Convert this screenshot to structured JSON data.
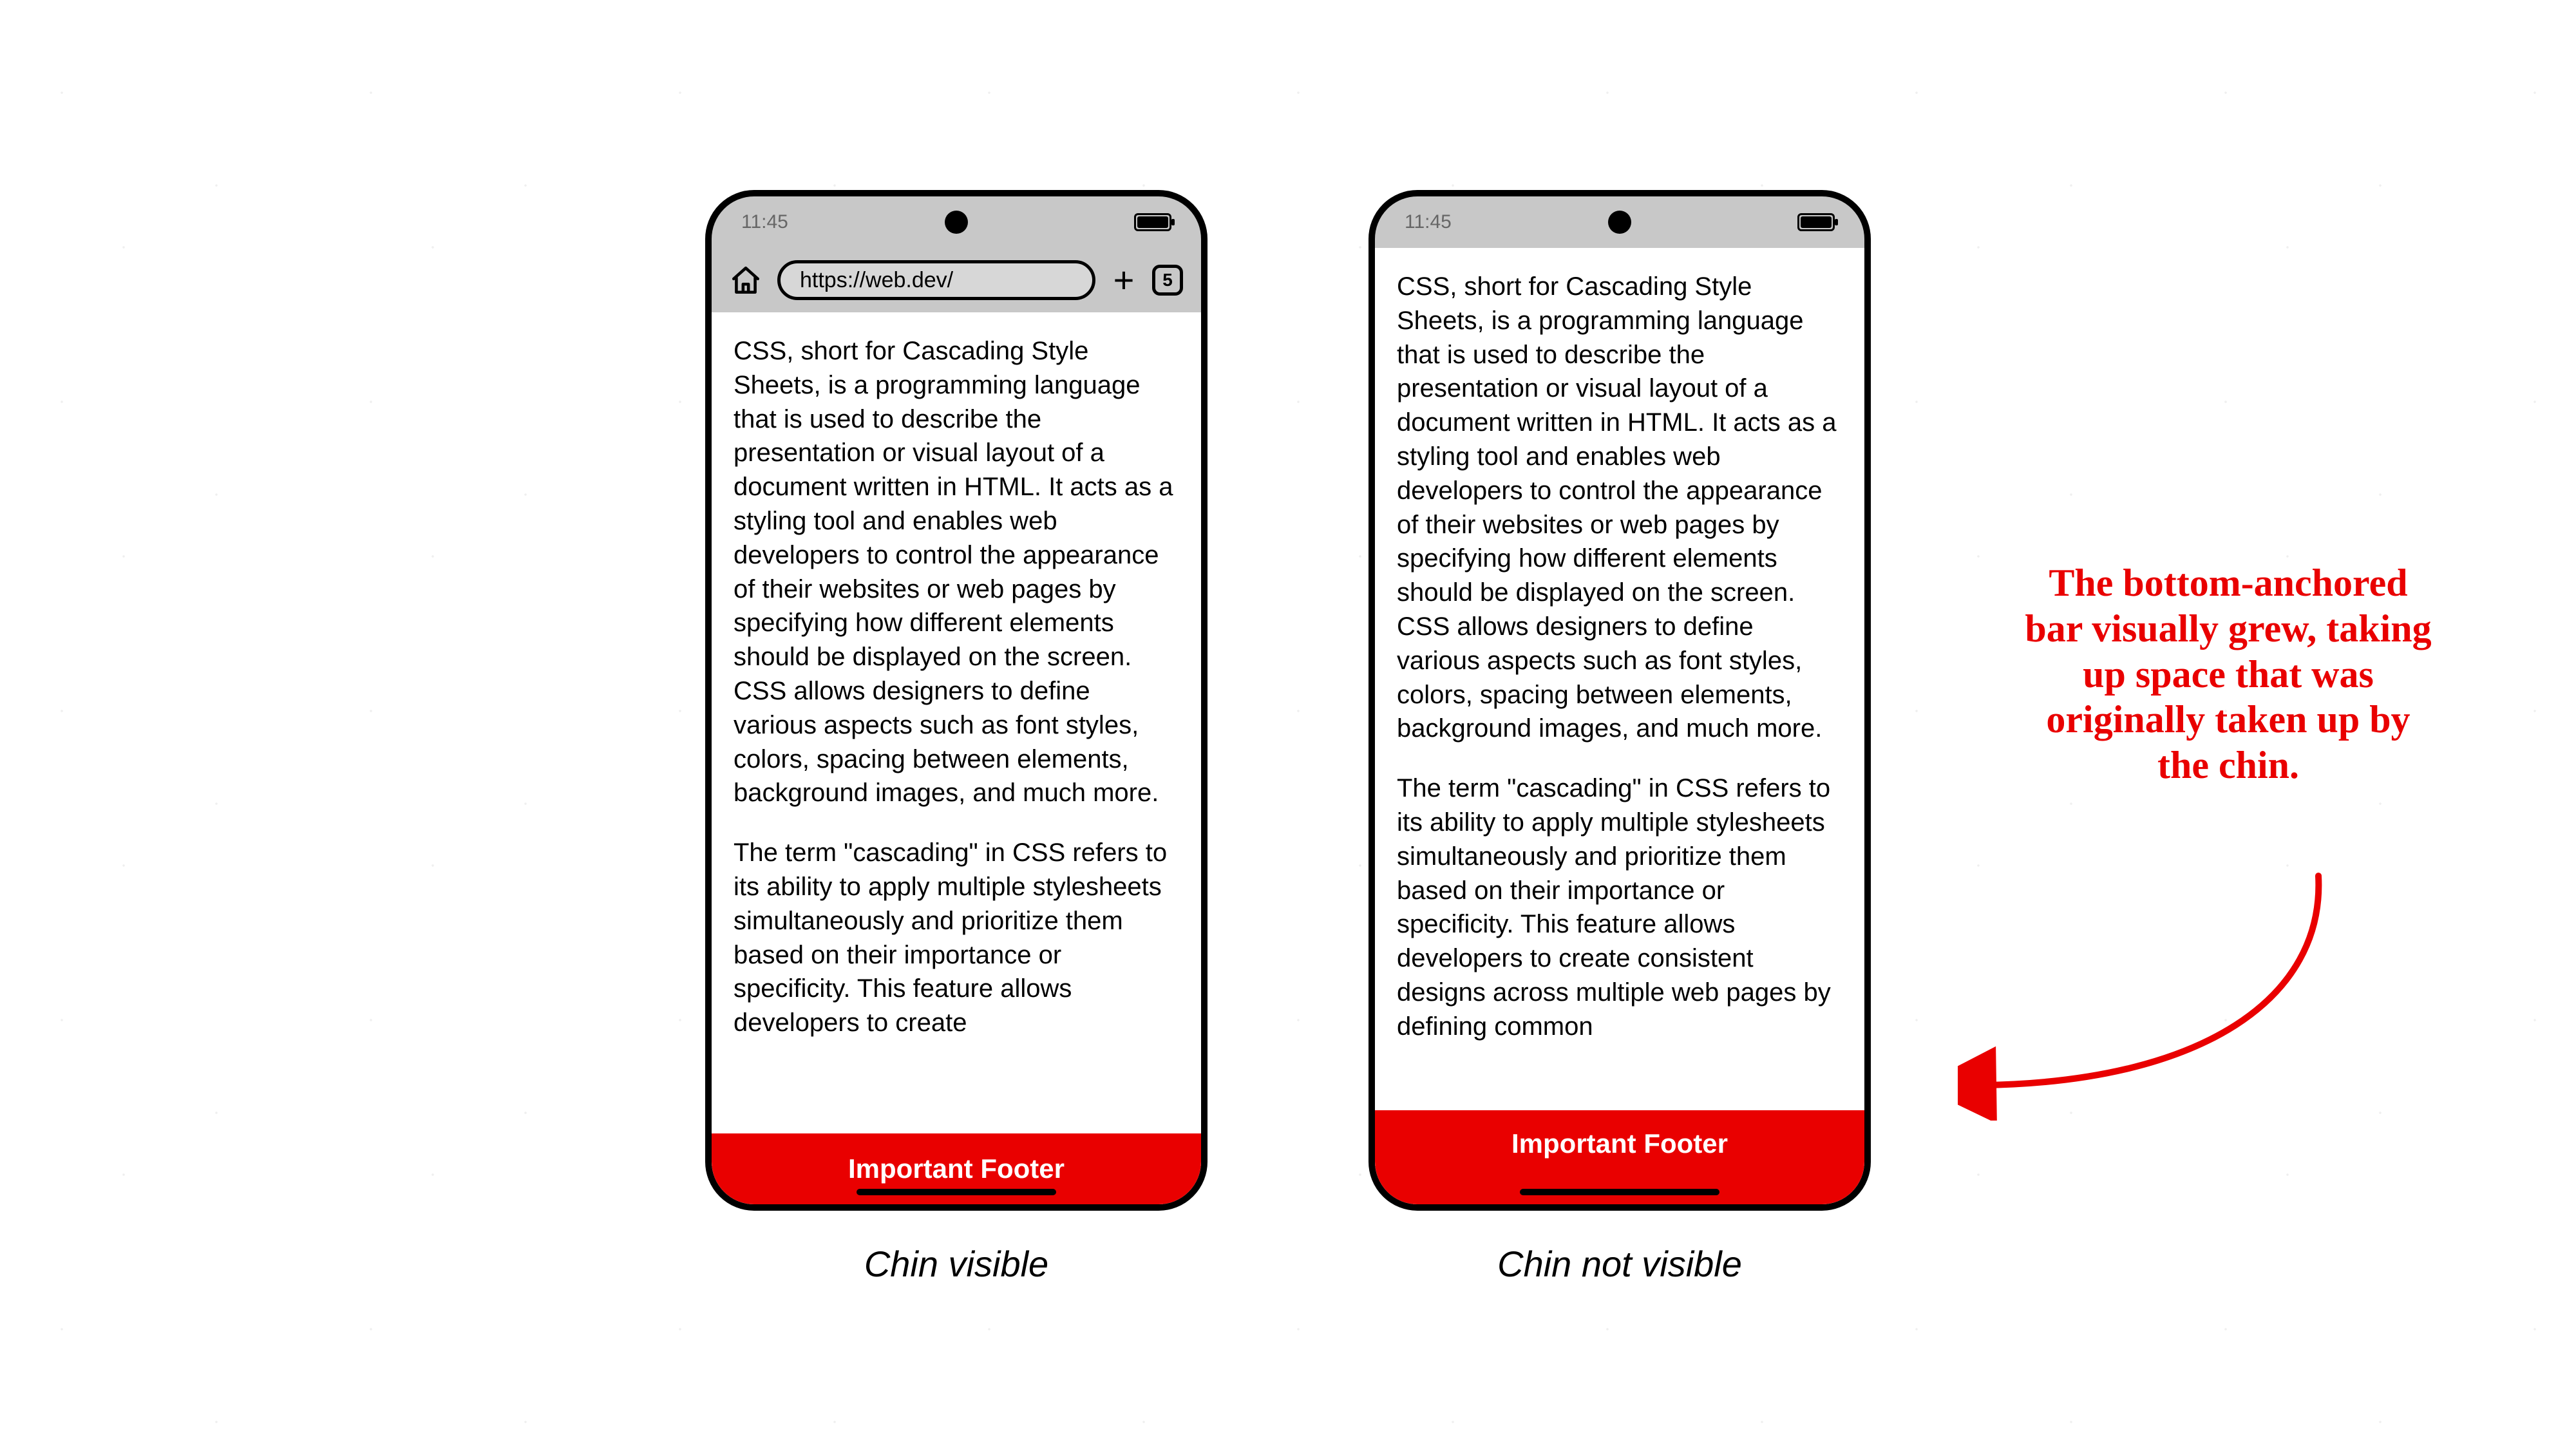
{
  "status": {
    "time": "11:45"
  },
  "browser": {
    "url": "https://web.dev/",
    "tab_count": "5",
    "plus_glyph": "+"
  },
  "page": {
    "para1": "CSS, short for Cascading Style Sheets, is a programming language that is used to describe the presentation or visual layout of a document written in HTML. It acts as a styling tool and enables web developers to control the appearance of their websites or web pages by specifying how different elements should be displayed on the screen. CSS allows designers to define various aspects such as font styles, colors, spacing between elements, background images, and much more.",
    "para2_short": "The term \"cascading\" in CSS refers to its ability to apply multiple stylesheets simultaneously and prioritize them based on their importance or specificity. This feature allows developers to create",
    "para2_long": "The term \"cascading\" in CSS refers to its ability to apply multiple stylesheets simultaneously and prioritize them based on their importance or specificity. This feature allows developers to create consistent designs across multiple web pages by defining common"
  },
  "footer": {
    "label": "Important Footer"
  },
  "captions": {
    "left": "Chin visible",
    "right": "Chin not visible"
  },
  "annotation": "The bottom-anchored bar visually grew, taking up space that was originally taken up by the chin.",
  "colors": {
    "accent_red": "#e90000"
  }
}
